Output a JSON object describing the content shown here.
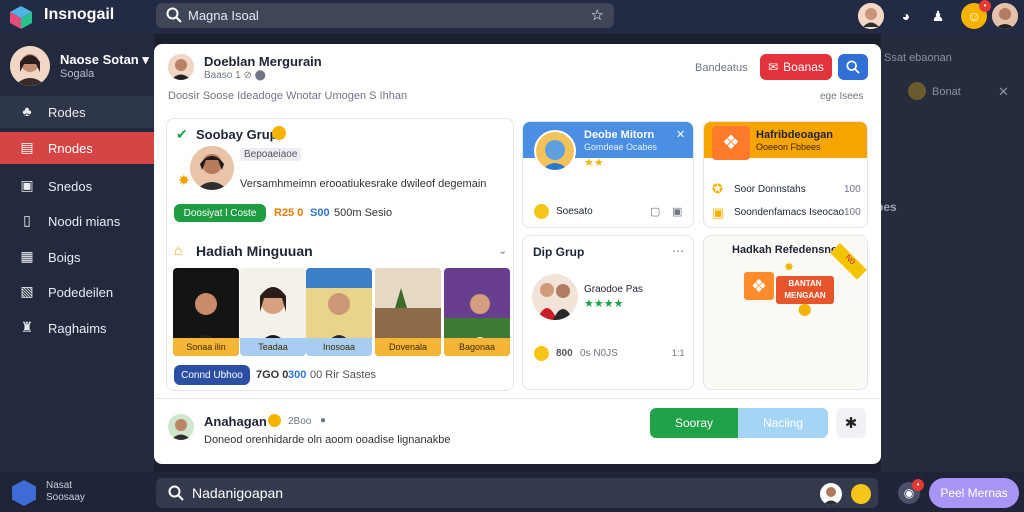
{
  "app": {
    "title": "Insnogail"
  },
  "search": {
    "value": "Magna Isoal"
  },
  "sidebar": {
    "profile": {
      "name": "Naose Sotan ▾",
      "sub": "Sogala"
    },
    "items": [
      {
        "label": "Rodes",
        "icon": "plant-icon"
      },
      {
        "label": "Rnodes",
        "icon": "archive-icon"
      },
      {
        "label": "Snedos",
        "icon": "briefcase-icon"
      },
      {
        "label": "Noodi mians",
        "icon": "document-icon"
      },
      {
        "label": "Boigs",
        "icon": "box-icon"
      },
      {
        "label": "Podedeilen",
        "icon": "note-icon"
      },
      {
        "label": "Raghaims",
        "icon": "people-icon"
      }
    ]
  },
  "header": {
    "name": "Doeblan Mergurain",
    "sub": "Baaso 1 ⊘ ⬤",
    "status": "Bandeatus",
    "button": "Boanas",
    "desc": "Doosir Soose Ideadoge Wnotar Umogen S Ihhan",
    "link": "ege Isees"
  },
  "group": {
    "title": "Soobay Grup",
    "tag": "Bepoaeiaoe",
    "desc": "Versamhmeimn erooatiukesrake dwileof degemain",
    "btn": "Doosiyat l Coste",
    "count1": "R25 0",
    "count2": "S00",
    "count3": "500m Sesio"
  },
  "weekly": {
    "title": "Hadiah Minguuan",
    "photos": [
      "Sonaa ilin",
      "Teadaa",
      "Inosoaa",
      "Dovenala",
      "Bagonaa"
    ],
    "btn": "Connd Ubhoo",
    "count1": "7GO 0",
    "count2": "300",
    "count3": "00 Rir Sastes"
  },
  "promo1": {
    "title": "Deobe Mitorn",
    "sub": "Gomdeae Ocabes",
    "stars": "★★",
    "label": "Soesato"
  },
  "promo2": {
    "title": "Hafribdeoagan",
    "sub": "Ooeeon Fbbees",
    "val1": "Soor Donnstahs",
    "num1": "100",
    "val2": "Soondenfamacs Iseocao",
    "num2": "100"
  },
  "dip": {
    "title": "Dip Grup",
    "name": "Graodoe Pas",
    "stars": "★★★★",
    "count": "800",
    "count2": "0s N0JS",
    "count3": "1:1"
  },
  "gift": {
    "title": "Hadkah Refedensne",
    "ribbon": "N0",
    "board": "BANTAN MENGAAN"
  },
  "bottom": {
    "name": "Anahagan",
    "time": "2Boo",
    "desc": "Doneod orenhidarde oln aoom ooadise lignanakbe",
    "btn1": "Sooray",
    "btn2": "Naciing",
    "icon": "settings-icon"
  },
  "rightpanel": {
    "item1": "Ssat ebaonan",
    "item2": "Bonat",
    "item3": "bes"
  },
  "bottombar": {
    "user": "Nasat Soosaay",
    "search": "Nadanigoapan",
    "pill": "Peel Mernas"
  }
}
